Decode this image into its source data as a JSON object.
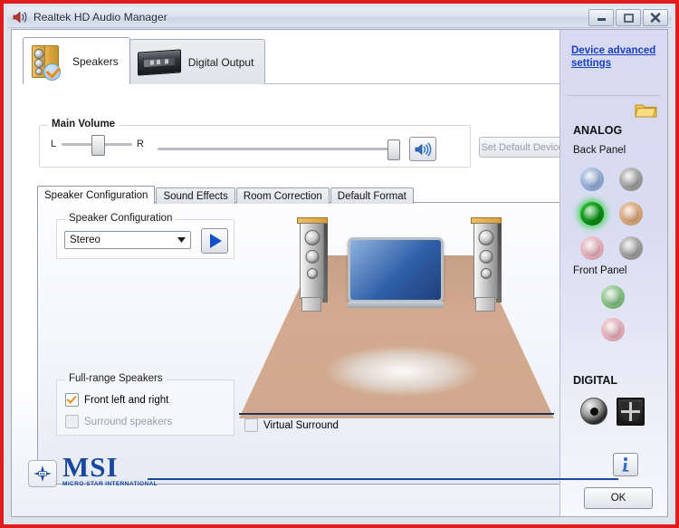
{
  "window": {
    "title": "Realtek HD Audio Manager",
    "icon": "realtek-speaker-icon",
    "controls": {
      "minimize": "—",
      "maximize": "▢",
      "close": "✕"
    }
  },
  "top_tabs": [
    {
      "label": "Speakers",
      "icon": "speakers-icon",
      "active": true
    },
    {
      "label": "Digital Output",
      "icon": "digital-output-icon",
      "active": false
    }
  ],
  "main_volume": {
    "caption": "Main Volume",
    "left_label": "L",
    "right_label": "R",
    "balance_percent": 50,
    "volume_percent": 100,
    "mute_icon": "speaker-volume-icon",
    "set_default_label": "Set Default Device",
    "set_default_enabled": false
  },
  "sub_tabs": [
    {
      "label": "Speaker Configuration",
      "active": true
    },
    {
      "label": "Sound Effects",
      "active": false
    },
    {
      "label": "Room Correction",
      "active": false
    },
    {
      "label": "Default Format",
      "active": false
    }
  ],
  "speaker_config": {
    "caption": "Speaker Configuration",
    "selected": "Stereo",
    "options": [
      "Stereo"
    ],
    "dropdown_icon": "chevron-down-icon",
    "play_icon": "play-icon"
  },
  "full_range": {
    "caption": "Full-range Speakers",
    "items": [
      {
        "label": "Front left and right",
        "checked": true,
        "enabled": true
      },
      {
        "label": "Surround speakers",
        "checked": false,
        "enabled": false
      }
    ]
  },
  "virtual_surround": {
    "label": "Virtual Surround",
    "checked": false
  },
  "right_panel": {
    "device_link": "Device advanced settings",
    "folder_icon": "folder-icon",
    "analog_header": "ANALOG",
    "back_panel_label": "Back Panel",
    "back_panel_jacks": [
      {
        "name": "jack-blue-line-in",
        "color": "#8fa8d4",
        "active": false
      },
      {
        "name": "jack-grey-side",
        "color": "#9a9a9a",
        "active": false
      },
      {
        "name": "jack-green-line-out",
        "color": "#0a8f12",
        "active": true
      },
      {
        "name": "jack-orange-center-sub",
        "color": "#d9a477",
        "active": false
      },
      {
        "name": "jack-pink-mic",
        "color": "#e3aab6",
        "active": false
      },
      {
        "name": "jack-grey-rear",
        "color": "#9a9a9a",
        "active": false
      }
    ],
    "front_panel_label": "Front Panel",
    "front_panel_jacks": [
      {
        "name": "jack-front-green-headphone",
        "color": "#7fbf7f",
        "active": false
      },
      {
        "name": "jack-front-pink-mic",
        "color": "#e3aab6",
        "active": false
      }
    ],
    "digital_header": "DIGITAL",
    "digital_jacks": [
      {
        "name": "coaxial-spdif-jack"
      },
      {
        "name": "optical-spdif-port"
      }
    ]
  },
  "footer": {
    "brand": "MSI",
    "brand_sub": "MICRO-STAR INTERNATIONAL",
    "info_icon": "info-icon",
    "ok_label": "OK"
  }
}
